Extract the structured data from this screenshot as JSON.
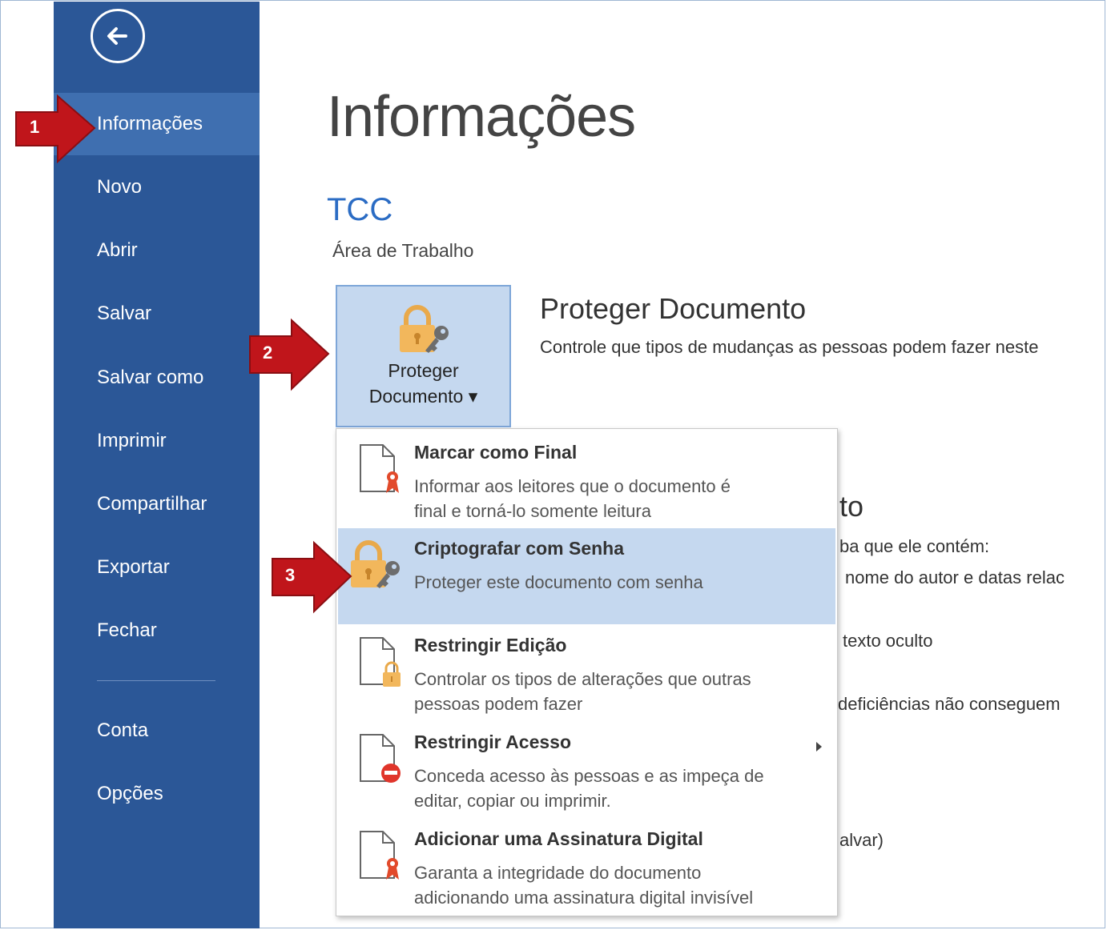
{
  "sidebar": {
    "back": "back-arrow-icon",
    "items": [
      {
        "label": "Informações"
      },
      {
        "label": "Novo"
      },
      {
        "label": "Abrir"
      },
      {
        "label": "Salvar"
      },
      {
        "label": "Salvar como"
      },
      {
        "label": "Imprimir"
      },
      {
        "label": "Compartilhar"
      },
      {
        "label": "Exportar"
      },
      {
        "label": "Fechar"
      },
      {
        "label": "Conta"
      },
      {
        "label": "Opções"
      }
    ]
  },
  "main": {
    "title": "Informações",
    "doc_name": "TCC",
    "doc_path": "Área de Trabalho",
    "protect_button": {
      "line1": "Proteger",
      "line2": "Documento ▾"
    },
    "protect_section": {
      "title": "Proteger Documento",
      "description": "Controle que tipos de mudanças as pessoas podem fazer neste"
    },
    "background_fragments": [
      "to",
      "ba que ele contém:",
      "nome do autor e datas relac",
      "texto oculto",
      "deficiências não conseguem",
      "alvar)"
    ]
  },
  "menu": {
    "items": [
      {
        "title": "Marcar como Final",
        "desc1": "Informar aos leitores que o documento é",
        "desc2": "final e torná-lo somente leitura",
        "icon": "document-ribbon-icon"
      },
      {
        "title": "Criptografar com Senha",
        "desc1": "Proteger este documento com senha",
        "desc2": "",
        "icon": "lock-key-icon"
      },
      {
        "title": "Restringir Edição",
        "desc1": "Controlar os tipos de alterações que outras",
        "desc2": "pessoas podem fazer",
        "icon": "document-lock-icon"
      },
      {
        "title": "Restringir Acesso",
        "desc1": "Conceda acesso às pessoas e as impeça de",
        "desc2": "editar, copiar ou imprimir.",
        "icon": "document-block-icon"
      },
      {
        "title": "Adicionar uma Assinatura Digital",
        "desc1": "Garanta a integridade do documento",
        "desc2": "adicionando uma assinatura digital invisível",
        "icon": "document-ribbon-icon"
      }
    ]
  },
  "callouts": [
    "1",
    "2",
    "3"
  ],
  "colors": {
    "sidebar": "#2b5797",
    "sidebar_active": "#3f6fb0",
    "highlight": "#c5d8ef",
    "accent": "#2b6cc4",
    "callout": "#c0151b"
  }
}
